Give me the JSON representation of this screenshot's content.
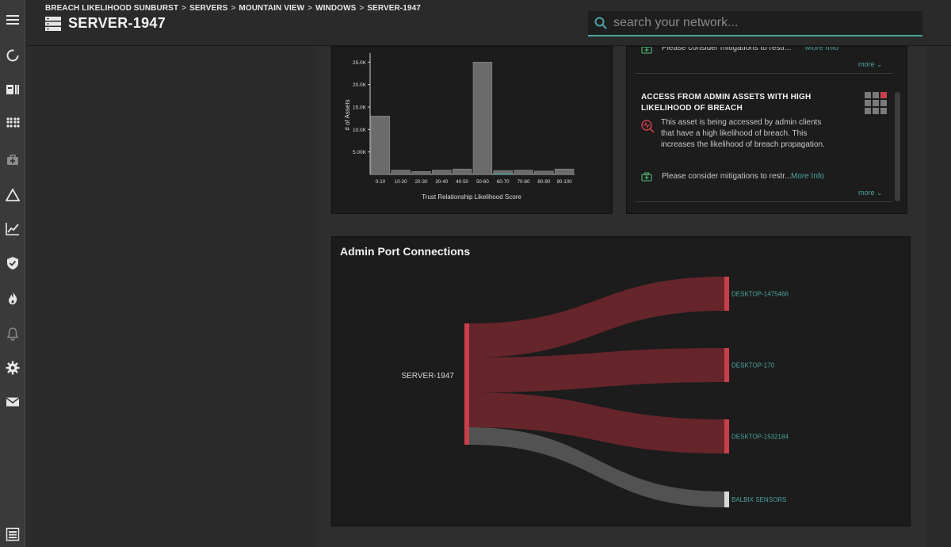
{
  "app": {
    "breadcrumb": [
      "BREACH LIKELIHOOD SUNBURST",
      "SERVERS",
      "MOUNTAIN VIEW",
      "WINDOWS",
      "SERVER-1947"
    ],
    "breadcrumb_sep": ">",
    "title": "SERVER-1947",
    "search_placeholder": "search your network..."
  },
  "sidebar": {
    "items": [
      {
        "icon": "menu-icon"
      },
      {
        "icon": "refresh-icon"
      },
      {
        "icon": "inventory-icon"
      },
      {
        "icon": "apps-icon"
      },
      {
        "icon": "medical-icon"
      },
      {
        "icon": "triangle-icon"
      },
      {
        "icon": "trend-icon"
      },
      {
        "icon": "shield-icon"
      },
      {
        "icon": "flame-icon"
      },
      {
        "icon": "bell-icon"
      },
      {
        "icon": "gear-icon"
      },
      {
        "icon": "mail-icon"
      },
      {
        "icon": "server-icon"
      }
    ]
  },
  "histogram": {
    "chart_data": {
      "type": "bar",
      "categories": [
        "0-10",
        "10-20",
        "20-30",
        "30-40",
        "40-50",
        "50-60",
        "60-70",
        "70-80",
        "80-90",
        "90-100"
      ],
      "values": [
        13000,
        950,
        650,
        950,
        1200,
        25000,
        850,
        950,
        750,
        1200
      ],
      "ylabel": "# of Assets",
      "xlabel": "Trust Relationship Likelihood Score",
      "yticks": [
        "5.00K",
        "10.0K",
        "15.0K",
        "20.0K",
        "25.0K"
      ],
      "ylim": [
        0,
        27000
      ]
    }
  },
  "insights": {
    "prev": {
      "mitigation_text": "Please consider mitigations to restr...",
      "more_info": "More Info",
      "more": "more"
    },
    "card": {
      "title": "ACCESS FROM ADMIN ASSETS WITH HIGH LIKELIHOOD OF BREACH",
      "description": "This asset is being accessed by admin clients that have a high likelihood of breach. This increases the likelihood of breach propagation.",
      "mitigation_text": "Please consider mitigations to restr...",
      "more_info": "More Info",
      "more": "more"
    },
    "colors": {
      "accent": "#4aa3a0",
      "danger": "#c8404a"
    }
  },
  "sankey": {
    "title": "Admin Port Connections",
    "chart_data": {
      "type": "sankey",
      "source": "SERVER-1947",
      "targets": [
        {
          "name": "DESKTOP-1475466",
          "color": "#6a262c"
        },
        {
          "name": "DESKTOP-170",
          "color": "#6a262c"
        },
        {
          "name": "DESKTOP-1532184",
          "color": "#6a262c"
        },
        {
          "name": "BALBIX SENSORS",
          "color": "#555555"
        }
      ]
    }
  }
}
